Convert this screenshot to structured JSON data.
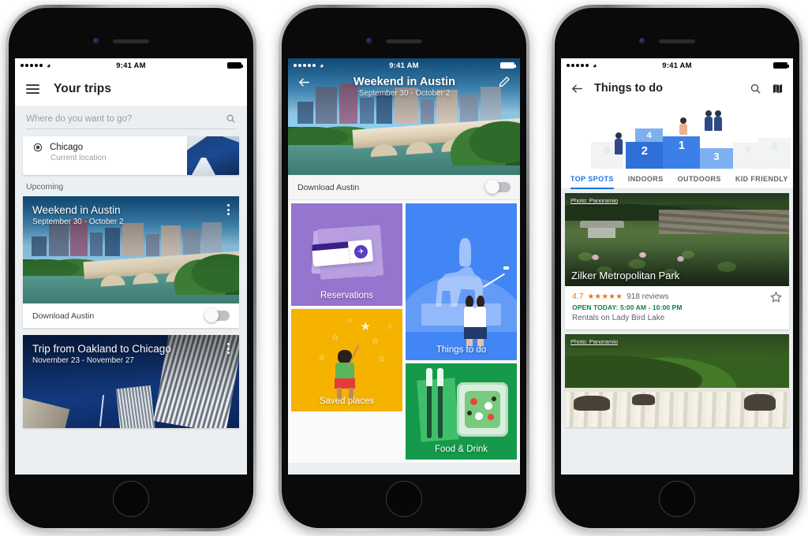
{
  "statusbar": {
    "time": "9:41 AM",
    "wifi_icon": "wifi-icon",
    "battery_icon": "battery-icon"
  },
  "phone1": {
    "menu_icon": "hamburger-menu-icon",
    "title": "Your trips",
    "search": {
      "placeholder": "Where do you want to go?",
      "icon": "search-icon"
    },
    "current_location": {
      "icon": "location-crosshair-icon",
      "name": "Chicago",
      "subtitle": "Current location"
    },
    "section_label": "Upcoming",
    "trips": [
      {
        "name": "Weekend in Austin",
        "dates": "September 30 - October 2",
        "menu_icon": "overflow-menu-icon",
        "download_label": "Download Austin",
        "download_toggle": "off"
      },
      {
        "name": "Trip from Oakland to Chicago",
        "dates": "November 23 - November 27",
        "menu_icon": "overflow-menu-icon"
      }
    ]
  },
  "phone2": {
    "back_icon": "back-arrow-icon",
    "title": "Weekend in Austin",
    "subtitle": "September 30 - October 2",
    "edit_icon": "pencil-edit-icon",
    "download_label": "Download Austin",
    "download_toggle": "off",
    "tiles": [
      {
        "label": "Reservations",
        "color": "#9575cd"
      },
      {
        "label": "Things to do",
        "color": "#4285f4"
      },
      {
        "label": "Saved places",
        "color": "#f5b300"
      },
      {
        "label": "Food & Drink",
        "color": "#159a4b"
      }
    ]
  },
  "phone3": {
    "back_icon": "back-arrow-icon",
    "title": "Things to do",
    "search_icon": "search-icon",
    "map_icon": "map-icon",
    "podium": {
      "blocks": [
        "6",
        "4",
        "2",
        "1",
        "3",
        "7",
        "8"
      ]
    },
    "tabs": [
      {
        "label": "TOP SPOTS",
        "active": true
      },
      {
        "label": "INDOORS",
        "active": false
      },
      {
        "label": "OUTDOORS",
        "active": false
      },
      {
        "label": "KID FRIENDLY",
        "active": false
      }
    ],
    "spots": [
      {
        "photo_credit": "Photo: Panoramio",
        "name": "Zilker Metropolitan Park",
        "rating": "4.7",
        "stars": "★★★★★",
        "reviews": "918 reviews",
        "open_status": "OPEN TODAY: 5:00 AM - 10:00 PM",
        "subtitle": "Rentals on Lady Bird Lake",
        "bookmark_icon": "star-outline-icon"
      },
      {
        "photo_credit": "Photo: Panoramio",
        "name": "",
        "bookmark_icon": "star-outline-icon"
      }
    ]
  },
  "colors": {
    "accent_blue": "#1a73e8",
    "open_green": "#0b8043",
    "rating_orange": "#e8710a"
  }
}
